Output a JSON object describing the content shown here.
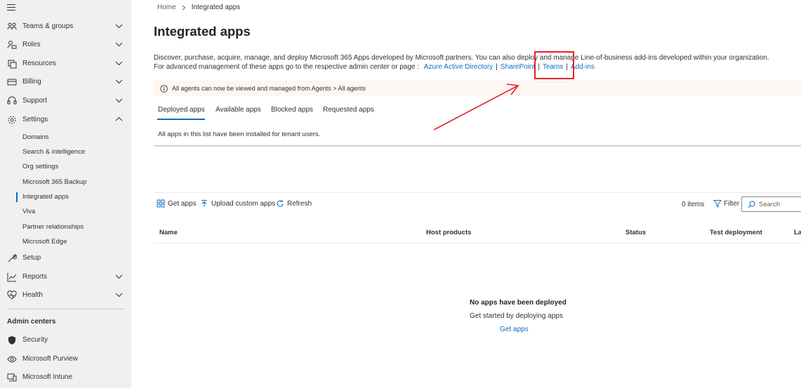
{
  "sidebar": {
    "items": [
      {
        "label": "Teams & groups",
        "icon": "teams-groups-icon",
        "chevron": "down"
      },
      {
        "label": "Roles",
        "icon": "roles-icon",
        "chevron": "down"
      },
      {
        "label": "Resources",
        "icon": "resources-icon",
        "chevron": "down"
      },
      {
        "label": "Billing",
        "icon": "billing-icon",
        "chevron": "down"
      },
      {
        "label": "Support",
        "icon": "support-icon",
        "chevron": "down"
      },
      {
        "label": "Settings",
        "icon": "settings-gear-icon",
        "chevron": "up"
      }
    ],
    "settings_sub": [
      "Domains",
      "Search & intelligence",
      "Org settings",
      "Microsoft 365 Backup",
      "Integrated apps",
      "Viva",
      "Partner relationships",
      "Microsoft Edge"
    ],
    "active_sub": "Integrated apps",
    "items_after": [
      {
        "label": "Setup",
        "icon": "setup-wrench-icon"
      },
      {
        "label": "Reports",
        "icon": "reports-chart-icon",
        "chevron": "down"
      },
      {
        "label": "Health",
        "icon": "health-heart-icon",
        "chevron": "down"
      }
    ],
    "admin_centers_heading": "Admin centers",
    "admin_centers": [
      {
        "label": "Security",
        "icon": "security-shield-icon"
      },
      {
        "label": "Microsoft Purview",
        "icon": "purview-icon"
      },
      {
        "label": "Microsoft Intune",
        "icon": "intune-icon"
      }
    ]
  },
  "breadcrumb": {
    "home": "Home",
    "current": "Integrated apps"
  },
  "page": {
    "title": "Integrated apps",
    "description_line1": "Discover, purchase, acquire, manage, and deploy Microsoft 365 Apps developed by Microsoft partners. You can also deploy and manage Line-of-business add-ins developed within your organization.",
    "description_line2_prefix": "For advanced management of these apps go to the respective admin center or page :",
    "links": [
      "Azure Active Directory",
      "SharePoint",
      "Teams",
      "Add-ins"
    ],
    "link_separator": "|"
  },
  "info_bar": {
    "text": "All agents can now be viewed and managed from Agents > All agents"
  },
  "tabs": [
    {
      "label": "Deployed apps",
      "selected": true
    },
    {
      "label": "Available apps",
      "selected": false
    },
    {
      "label": "Blocked apps",
      "selected": false
    },
    {
      "label": "Requested apps",
      "selected": false
    }
  ],
  "tab_note": "All apps in this list have been installed for tenant users.",
  "toolbar": {
    "get_apps": "Get apps",
    "upload_custom_apps": "Upload custom apps",
    "refresh": "Refresh",
    "items_count": "0 items",
    "filter": "Filter",
    "search_placeholder": "Search"
  },
  "table": {
    "columns": [
      "Name",
      "Host products",
      "Status",
      "Test deployment",
      "La"
    ]
  },
  "empty_state": {
    "title": "No apps have been deployed",
    "subtitle": "Get started by deploying apps",
    "link": "Get apps"
  },
  "colors": {
    "accent": "#0f6cbd",
    "annotation": "#e3202e",
    "sidebar_bg": "#f0f0f0",
    "info_bg": "#fdf6f1"
  }
}
